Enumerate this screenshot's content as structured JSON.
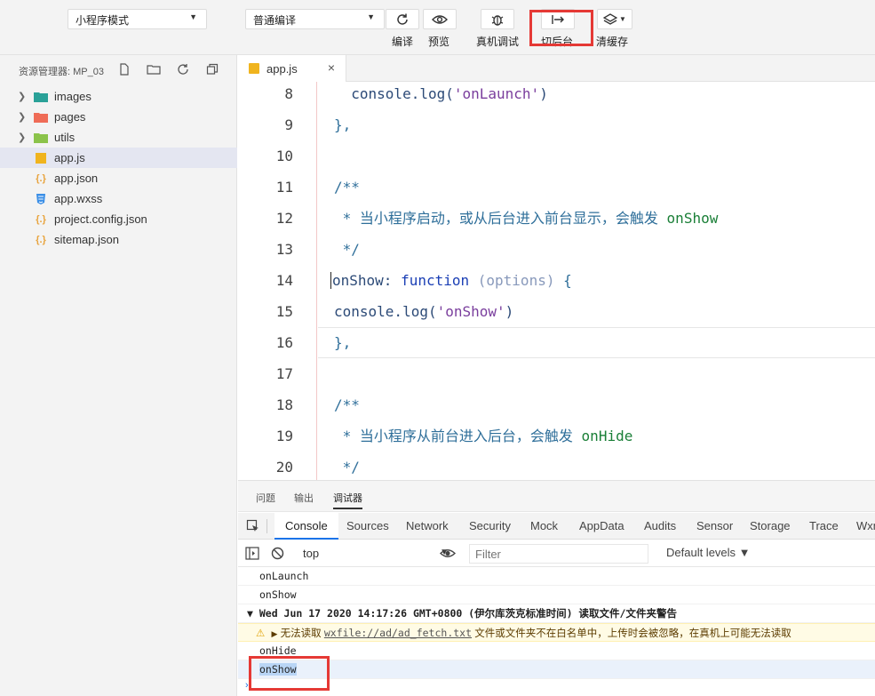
{
  "toolbar": {
    "mode_select": "小程序模式",
    "compile_select": "普通编译",
    "buttons": {
      "compile": "编译",
      "preview": "预览",
      "remote_debug": "真机调试",
      "background": "切后台",
      "clear_cache": "清缓存"
    }
  },
  "explorer": {
    "title": "资源管理器: MP_03",
    "items": [
      {
        "label": "images",
        "type": "folder"
      },
      {
        "label": "pages",
        "type": "folder"
      },
      {
        "label": "utils",
        "type": "folder"
      },
      {
        "label": "app.js",
        "type": "js"
      },
      {
        "label": "app.json",
        "type": "json"
      },
      {
        "label": "app.wxss",
        "type": "wxss"
      },
      {
        "label": "project.config.json",
        "type": "json"
      },
      {
        "label": "sitemap.json",
        "type": "json"
      }
    ]
  },
  "editor": {
    "tab_label": "app.js",
    "close_glyph": "×",
    "lines": [
      {
        "no": "8",
        "text": "  console.log('onLaunch')"
      },
      {
        "no": "9",
        "text": "},"
      },
      {
        "no": "10",
        "text": ""
      },
      {
        "no": "11",
        "text": "/**"
      },
      {
        "no": "12",
        "text": " * 当小程序启动，或从后台进入前台显示，会触发 onShow"
      },
      {
        "no": "13",
        "text": " */"
      },
      {
        "no": "14",
        "text": "onShow: function (options) {"
      },
      {
        "no": "15",
        "text": "  console.log('onShow')"
      },
      {
        "no": "16",
        "text": "},"
      },
      {
        "no": "17",
        "text": ""
      },
      {
        "no": "18",
        "text": "/**"
      },
      {
        "no": "19",
        "text": " * 当小程序从前台进入后台，会触发 onHide"
      },
      {
        "no": "20",
        "text": " */"
      }
    ]
  },
  "panel": {
    "tabs": [
      "问题",
      "输出",
      "调试器"
    ],
    "devtools_tabs": [
      "Console",
      "Sources",
      "Network",
      "Security",
      "Mock",
      "AppData",
      "Audits",
      "Sensor",
      "Storage",
      "Trace",
      "Wxml"
    ],
    "context": "top",
    "filter_placeholder": "Filter",
    "levels": "Default levels ▼",
    "logs": {
      "l1": "onLaunch",
      "l2": "onShow",
      "group": "Wed Jun 17 2020 14:17:26 GMT+0800 (伊尔库茨克标准时间) 读取文件/文件夹警告",
      "warn_prefix": "无法读取",
      "warn_link": "wxfile://ad/ad_fetch.txt",
      "warn_suffix": "文件或文件夹不在白名单中，上传时会被忽略，在真机上可能无法读取",
      "l4": "onHide",
      "l5": "onShow"
    }
  },
  "colors": {
    "highlight_box": "#e53935",
    "accent": "#1a73e8"
  }
}
